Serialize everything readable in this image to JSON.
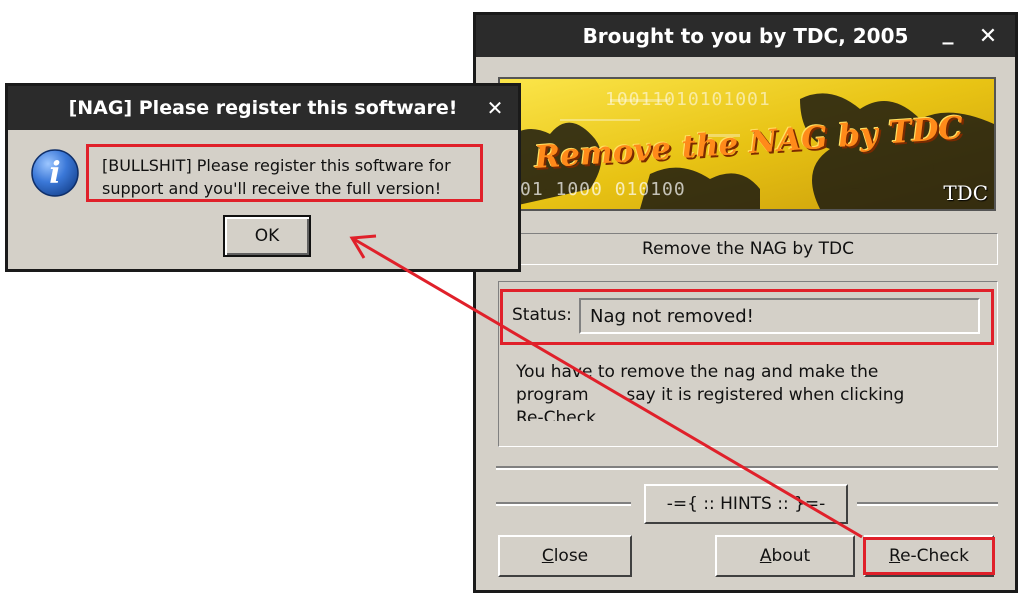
{
  "main_window": {
    "title": "Brought to you by TDC, 2005",
    "minimize_glyph": "_",
    "close_glyph": "✕",
    "banner": {
      "headline": "Remove the NAG by TDC",
      "binary_line_1": "10011010101001",
      "binary_line_2": "01  1000 010100",
      "logo": "TDC"
    },
    "subtitle": "Remove the NAG by TDC",
    "status_label": "Status:",
    "status_value": "Nag not removed!",
    "instructions_line1": "You have to remove the nag and make the",
    "instructions_line2": "program       say it is registered when clicking",
    "instructions_line3": "Re-Check",
    "hints_button": "-={ :: HINTS :: }=-",
    "close_button": {
      "accel": "C",
      "rest": "lose"
    },
    "about_button": {
      "accel": "A",
      "rest": "bout"
    },
    "recheck_button": {
      "accel": "R",
      "rest": "e-Check"
    }
  },
  "nag_dialog": {
    "title": "[NAG] Please register this software!",
    "close_glyph": "✕",
    "icon": "info-icon",
    "message_line1": "[BULLSHIT] Please register this software for",
    "message_line2": "support and you'll receive the full version!",
    "ok_button": "OK"
  },
  "colors": {
    "highlight_red": "#e0202a",
    "titlebar": "#2b2b2b",
    "window_face": "#d4d0c8",
    "banner_yellow": "#f2d21a"
  }
}
